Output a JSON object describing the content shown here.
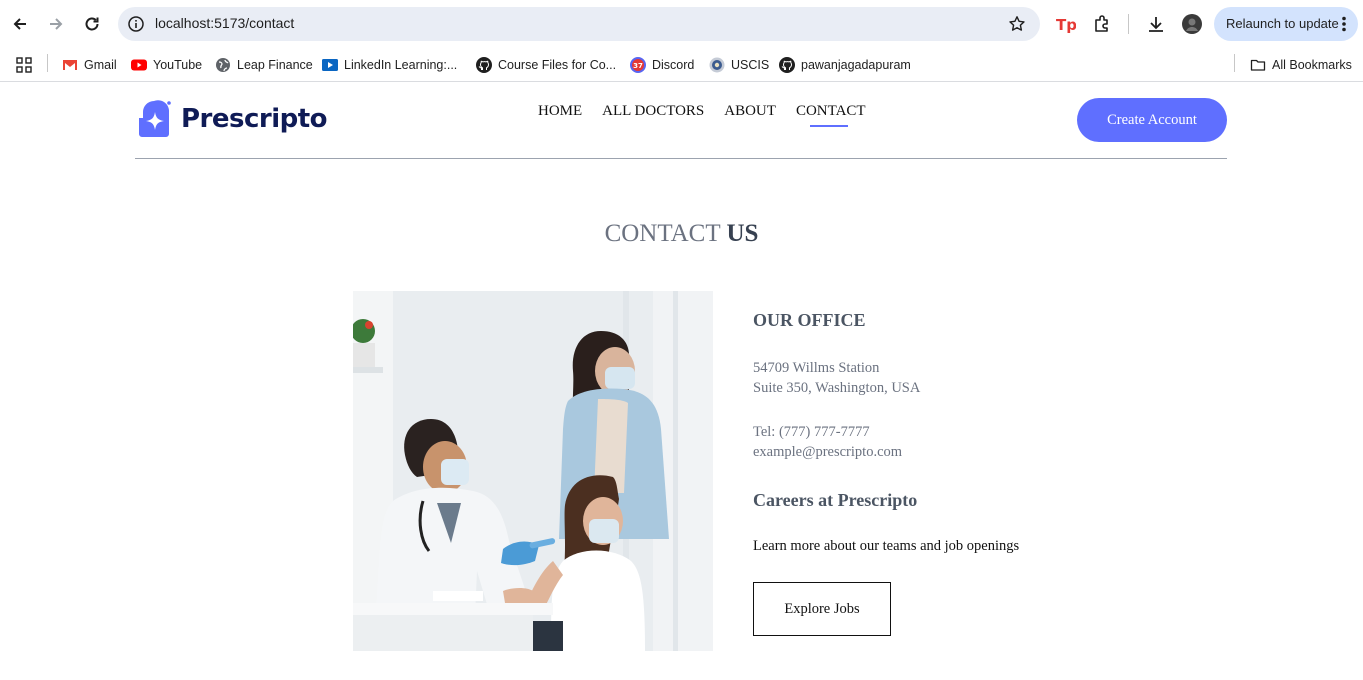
{
  "browser": {
    "url": "localhost:5173/contact",
    "relaunch_label": "Relaunch to update",
    "bookmarks": [
      {
        "label": "Gmail",
        "icon": "gmail-icon"
      },
      {
        "label": "YouTube",
        "icon": "youtube-icon"
      },
      {
        "label": "Leap Finance",
        "icon": "globe-icon"
      },
      {
        "label": "LinkedIn Learning:...",
        "icon": "linkedin-learning-icon"
      },
      {
        "label": "Course Files for Co...",
        "icon": "github-icon"
      },
      {
        "label": "Discord",
        "icon": "discord-icon"
      },
      {
        "label": "USCIS",
        "icon": "uscis-icon"
      },
      {
        "label": "pawanjagadapuram",
        "icon": "github-icon"
      }
    ],
    "all_bookmarks_label": "All Bookmarks",
    "discord_badge": "37"
  },
  "site": {
    "brand": "Prescripto",
    "nav": [
      "HOME",
      "ALL DOCTORS",
      "ABOUT",
      "CONTACT"
    ],
    "active_nav": "CONTACT",
    "create_account_label": "Create Account",
    "accent_color": "#5f6fff"
  },
  "page": {
    "title_light": "CONTACT",
    "title_bold": "US",
    "office_heading": "OUR OFFICE",
    "address_line1": "54709 Willms Station",
    "address_line2": "Suite 350, Washington, USA",
    "tel": "Tel: (777) 777-7777",
    "email": "example@prescripto.com",
    "careers_heading": "Careers at Prescripto",
    "careers_text": "Learn more about our teams and job openings",
    "explore_jobs_label": "Explore Jobs"
  }
}
